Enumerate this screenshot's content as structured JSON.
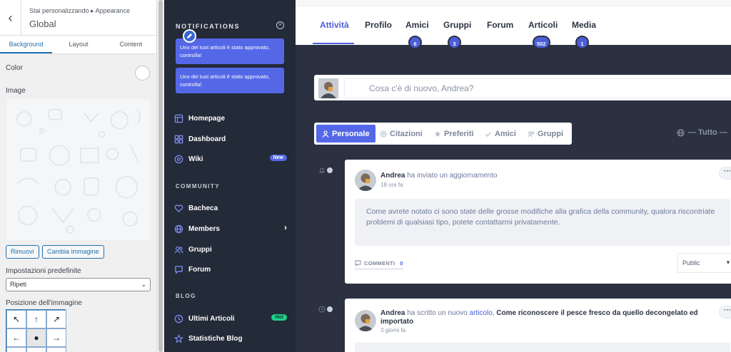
{
  "customizer": {
    "breadcrumb": "Stai personalizzando ▸ Appearance",
    "title": "Global",
    "tabs": [
      "Background",
      "Layout",
      "Content"
    ],
    "active_tab": "Background",
    "color_label": "Color",
    "image_label": "Image",
    "remove_button": "Rimuovi",
    "change_image_button": "Cambia immagine",
    "preset_label": "Impostazioni predefinite",
    "repeat_value": "Ripeti",
    "position_label": "Posizione dell'immagine",
    "position_grid": [
      "↖",
      "↑",
      "↗",
      "←",
      "●",
      "→"
    ]
  },
  "sidebar": {
    "notifications_title": "NOTIFICATIONS",
    "notifications": [
      "Uno dei tuoi articoli è stato approvato, controlla!",
      "Uno dei tuoi articoli è stato approvato, controlla!"
    ],
    "items": [
      {
        "label": "Homepage",
        "icon": "homepage-icon"
      },
      {
        "label": "Dashboard",
        "icon": "dashboard-icon"
      },
      {
        "label": "Wiki",
        "icon": "wiki-icon",
        "badge": "New"
      }
    ],
    "community_title": "COMMUNITY",
    "community_items": [
      {
        "label": "Bacheca",
        "icon": "heart-icon"
      },
      {
        "label": "Members",
        "icon": "globe-icon",
        "chevron": "›"
      },
      {
        "label": "Gruppi",
        "icon": "users-icon"
      },
      {
        "label": "Forum",
        "icon": "chat-icon"
      }
    ],
    "blog_title": "BLOG",
    "blog_items": [
      {
        "label": "Ultimi Articoli",
        "icon": "clock-icon",
        "badge": "Hot"
      },
      {
        "label": "Statistiche Blog",
        "icon": "star-icon"
      }
    ],
    "colors": {
      "bg": "#232a38",
      "accent": "#5468e7",
      "new_badge": "#5468e7",
      "hot_badge": "#1fd08a"
    }
  },
  "main": {
    "tabs": [
      {
        "label": "Attività",
        "active": true
      },
      {
        "label": "Profilo"
      },
      {
        "label": "Amici",
        "count": "6"
      },
      {
        "label": "Gruppi",
        "count": "3"
      },
      {
        "label": "Forum"
      },
      {
        "label": "Articoli",
        "count": "502"
      },
      {
        "label": "Media",
        "count": "1"
      }
    ],
    "post_placeholder": "Cosa c'è di nuovo, Andrea?",
    "filters": [
      {
        "label": "Personale",
        "icon": "user-icon",
        "active": true
      },
      {
        "label": "Citazioni",
        "icon": "at-icon"
      },
      {
        "label": "Preferiti",
        "icon": "star-icon"
      },
      {
        "label": "Amici",
        "icon": "check-icon"
      },
      {
        "label": "Gruppi",
        "icon": "users-icon"
      }
    ],
    "scope": "— Tutto —",
    "activities": [
      {
        "author": "Andrea",
        "action": "ha inviato un aggiornamento",
        "time": "18 ore fa",
        "content": "Come avrete notato ci sono state delle grosse modifiche alla grafica della community, qualora riscontriate problemi di qualsiasi tipo, potete contattarmi privatamente.",
        "comments_label": "COMMENTI",
        "comments_count": "0",
        "visibility": "Public",
        "more": "···"
      },
      {
        "author": "Andrea",
        "action": "ha scritto un nuovo",
        "link": "articolo",
        "sep": ",",
        "title": "Come riconoscere il pesce fresco da quello decongelato ed importato",
        "time": "3 giorni fa",
        "more": "···"
      }
    ],
    "colors": {
      "accent": "#4b5ed8",
      "dark_bg": "#2b3141"
    }
  }
}
